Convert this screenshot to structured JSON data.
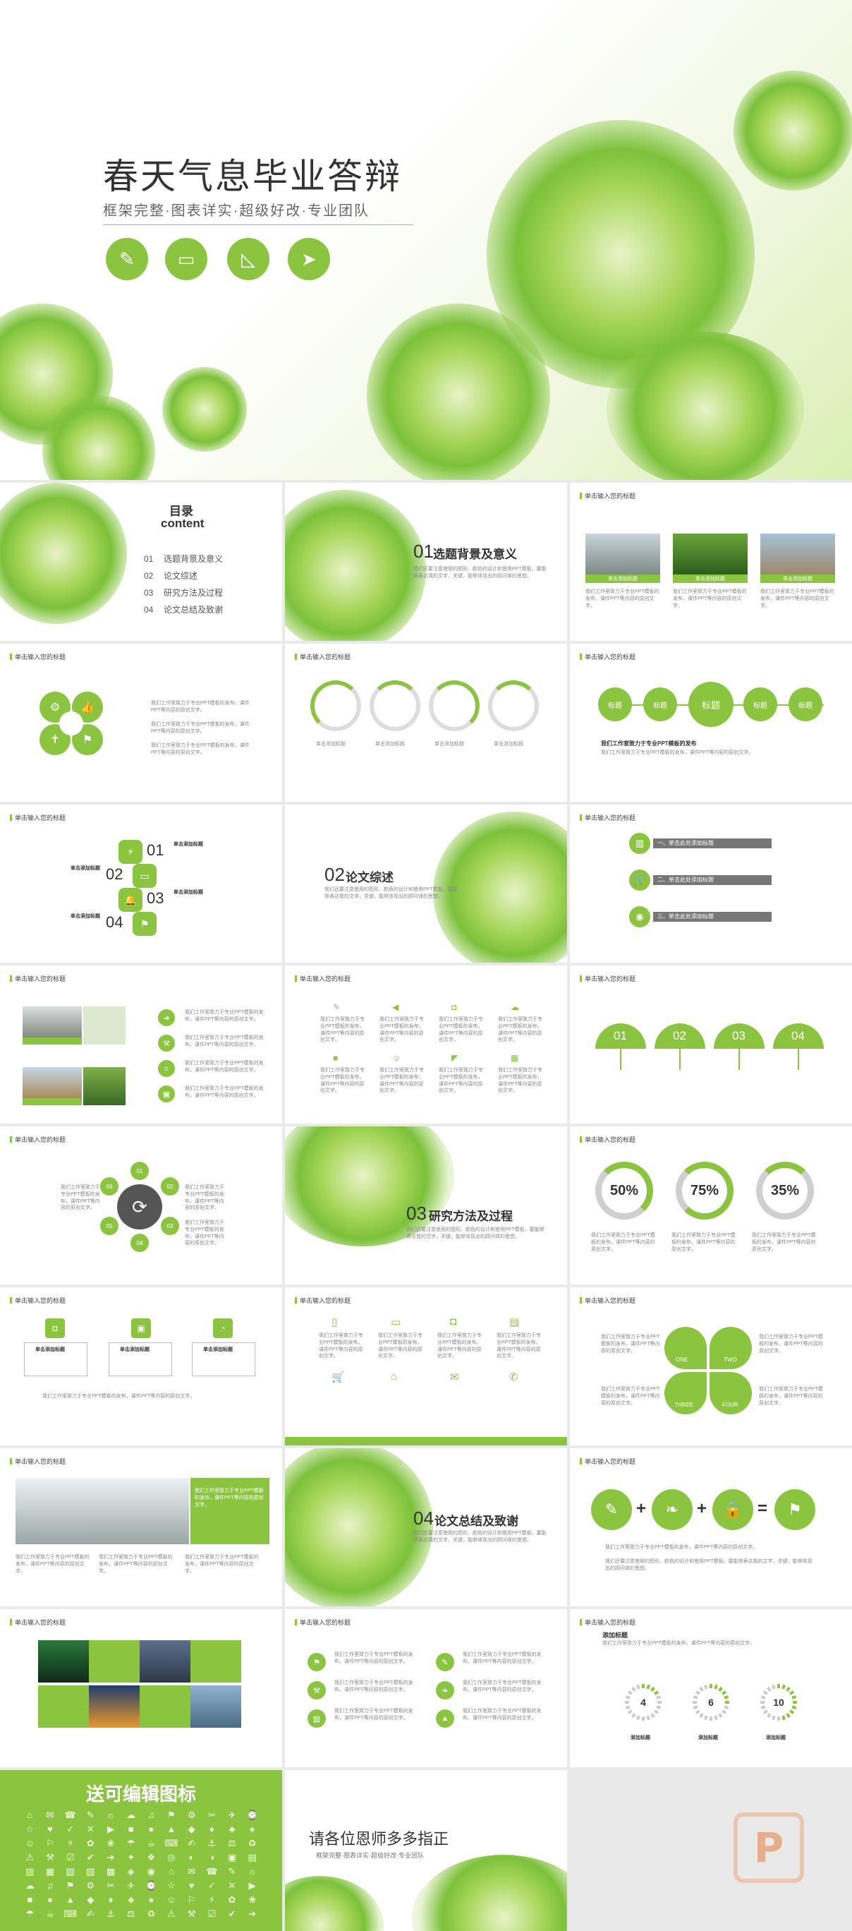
{
  "cover": {
    "title": "春天气息毕业答辩",
    "subtitle": "框架完整·图表详实·超级好改·专业团队",
    "icons": [
      "pencil-icon",
      "book-icon",
      "ruler-icon",
      "cursor-icon"
    ]
  },
  "slide_header": "单击输入您的标题",
  "toc": {
    "title": "目录",
    "title_en": "content",
    "items": [
      {
        "num": "01",
        "label": "选题背景及意义"
      },
      {
        "num": "02",
        "label": "论文综述"
      },
      {
        "num": "03",
        "label": "研究方法及过程"
      },
      {
        "num": "04",
        "label": "论文总结及致谢"
      }
    ]
  },
  "sections": [
    {
      "num": "01",
      "title": "选题背景及意义"
    },
    {
      "num": "02",
      "title": "论文综述"
    },
    {
      "num": "03",
      "title": "研究方法及过程"
    },
    {
      "num": "04",
      "title": "论文总结及致谢"
    }
  ],
  "section_body": "我们还要注意使用的图形、颜色的设计和使用PPT模板，要能够表达我的文字，关键，能够体现出的顾问体的思想。",
  "photo_captions": [
    "单击添加标题",
    "单击添加标题",
    "单击添加标题"
  ],
  "circle_labels": [
    "单击添加标题",
    "单击添加标题",
    "单击添加标题",
    "单击添加标题"
  ],
  "tag_labels": [
    "标题",
    "标题",
    "标题",
    "标题",
    "标题"
  ],
  "tag_body": "我们工作室致力于专业PPT模板的发布",
  "hex_numbers": [
    "01",
    "02",
    "03",
    "04"
  ],
  "hex_title": "单击添加标题",
  "banners": [
    "一、单击此处添加标题",
    "二、单击此处添加标题",
    "三、单击此处添加标题"
  ],
  "umbrella_numbers": [
    "01",
    "02",
    "03",
    "04"
  ],
  "percents": [
    "50%",
    "75%",
    "35%"
  ],
  "clover_labels": [
    "ONE",
    "TWO",
    "THREE",
    "FOUR"
  ],
  "steps": [
    {
      "value": 4,
      "label": "添加标题"
    },
    {
      "value": 6,
      "label": "添加标题"
    },
    {
      "value": 10,
      "label": "添加标题"
    }
  ],
  "steps_title": "添加标题",
  "icons_slide_title": "送可编辑图标",
  "thanks": {
    "title": "请各位恩师多多指正",
    "subtitle": "框架完整·图表详实·超级好改·专业团队"
  },
  "lorem": "我们工作室致力于专业PPT模板的发布，课件PPT等内容的原创文字。",
  "colors": {
    "accent": "#8bc53f",
    "dark": "#555555",
    "gray": "#999999"
  },
  "logo": {
    "letter": "P",
    "color": "#e8a880"
  }
}
